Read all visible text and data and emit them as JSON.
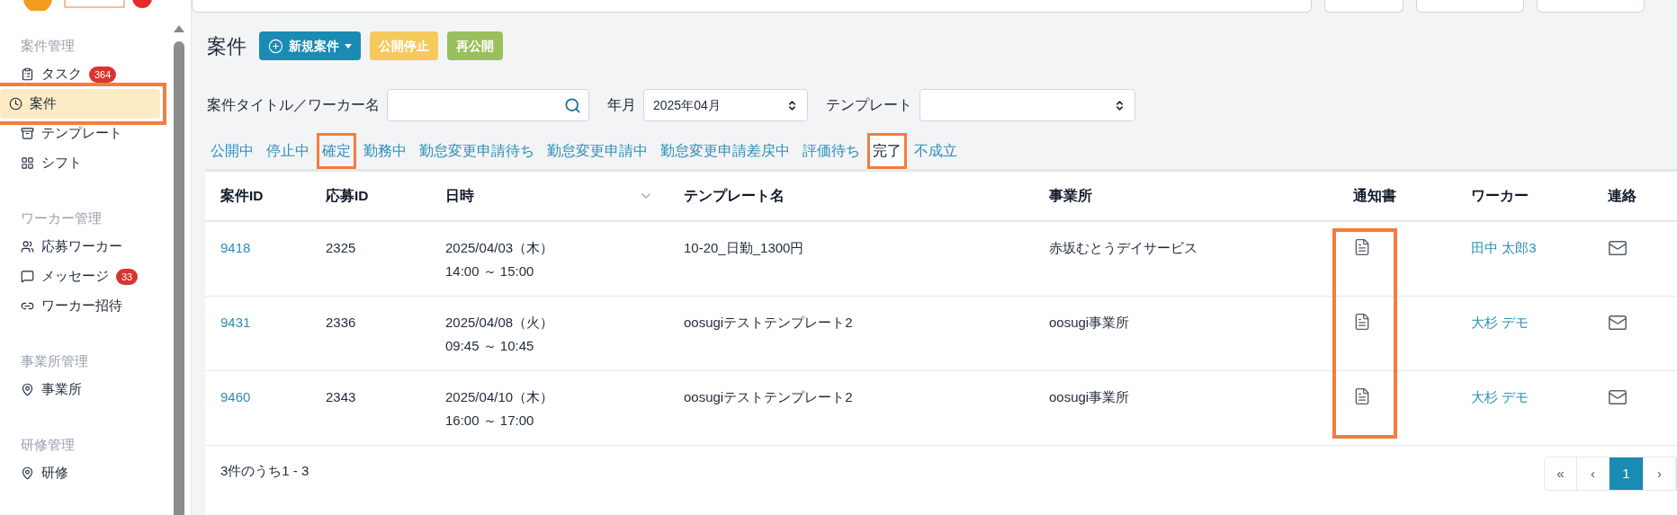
{
  "sidebar": {
    "sections": [
      {
        "title": "案件管理",
        "items": [
          {
            "label": "タスク",
            "badge": "364",
            "selected": false,
            "highlighted": false
          },
          {
            "label": "案件",
            "selected": true,
            "highlighted": true
          },
          {
            "label": "テンプレート",
            "selected": false,
            "highlighted": false
          },
          {
            "label": "シフト",
            "selected": false,
            "highlighted": false
          }
        ]
      },
      {
        "title": "ワーカー管理",
        "items": [
          {
            "label": "応募ワーカー",
            "selected": false,
            "highlighted": false
          },
          {
            "label": "メッセージ",
            "badge": "33",
            "selected": false,
            "highlighted": false
          },
          {
            "label": "ワーカー招待",
            "selected": false,
            "highlighted": false
          }
        ]
      },
      {
        "title": "事業所管理",
        "items": [
          {
            "label": "事業所",
            "selected": false,
            "highlighted": false
          }
        ]
      },
      {
        "title": "研修管理",
        "items": [
          {
            "label": "研修",
            "selected": false,
            "highlighted": false
          }
        ]
      }
    ]
  },
  "page": {
    "title": "案件",
    "buttons": [
      {
        "label": "新規案件",
        "kind": "primary"
      },
      {
        "label": "公開停止",
        "kind": "warning"
      },
      {
        "label": "再公開",
        "kind": "success"
      }
    ]
  },
  "filters": [
    {
      "label": "案件タイトル／ワーカー名",
      "kind": "search"
    },
    {
      "label": "年月",
      "kind": "select",
      "value": "2025年04月"
    },
    {
      "label": "テンプレート",
      "kind": "select"
    }
  ],
  "tabs": [
    {
      "label": "公開中",
      "selected": false,
      "highlighted": false
    },
    {
      "label": "停止中",
      "selected": false,
      "highlighted": false
    },
    {
      "label": "確定",
      "selected": false,
      "highlighted": true
    },
    {
      "label": "勤務中",
      "selected": false,
      "highlighted": false
    },
    {
      "label": "勤怠変更申請待ち",
      "selected": false,
      "highlighted": false
    },
    {
      "label": "勤怠変更申請中",
      "selected": false,
      "highlighted": false
    },
    {
      "label": "勤怠変更申請差戻中",
      "selected": false,
      "highlighted": false
    },
    {
      "label": "評価待ち",
      "selected": false,
      "highlighted": false
    },
    {
      "label": "完了",
      "selected": true,
      "highlighted": true
    },
    {
      "label": "不成立",
      "selected": false,
      "highlighted": false
    }
  ],
  "table": {
    "columns": [
      {
        "label": "案件ID",
        "highlighted": false
      },
      {
        "label": "応募ID",
        "highlighted": false
      },
      {
        "label": "日時",
        "sortable": true,
        "highlighted": false
      },
      {
        "label": "テンプレート名",
        "highlighted": false
      },
      {
        "label": "事業所",
        "highlighted": false
      },
      {
        "label": "通知書",
        "highlighted": true
      },
      {
        "label": "ワーカー",
        "highlighted": false
      },
      {
        "label": "連絡",
        "highlighted": false
      }
    ],
    "rows": [
      {
        "id": "9418",
        "apply_id": "2325",
        "date": "2025/04/03（木）",
        "time": "14:00 ～ 15:00",
        "template": "10-20_日勤_1300円",
        "office": "赤坂むとうデイサービス",
        "worker": "田中 太郎3"
      },
      {
        "id": "9431",
        "apply_id": "2336",
        "date": "2025/04/08（火）",
        "time": "09:45 ～ 10:45",
        "template": "oosugiテストテンプレート2",
        "office": "oosugi事業所",
        "worker": "大杉 デモ"
      },
      {
        "id": "9460",
        "apply_id": "2343",
        "date": "2025/04/10（木）",
        "time": "16:00 ～ 17:00",
        "template": "oosugiテストテンプレート2",
        "office": "oosugi事業所",
        "worker": "大杉 デモ"
      }
    ]
  },
  "footer": {
    "summary": "3件のうち1 - 3",
    "pagination": [
      {
        "label": "«",
        "selected": false
      },
      {
        "label": "‹",
        "selected": false
      },
      {
        "label": "1",
        "selected": true
      },
      {
        "label": "›",
        "selected": false
      }
    ]
  }
}
